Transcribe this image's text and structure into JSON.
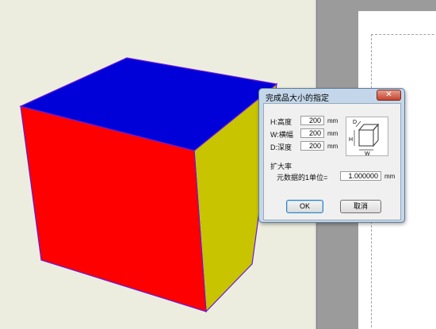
{
  "dialog": {
    "title": "完成品大小的指定",
    "close_glyph": "✕",
    "height_label": "H:高度",
    "height_value": "200",
    "width_label": "W:横幅",
    "width_value": "200",
    "depth_label": "D:深度",
    "depth_value": "200",
    "unit": "mm",
    "scale_heading": "扩大率",
    "scale_label": "元数据的1单位=",
    "scale_value": "1.000000",
    "ok_label": "OK",
    "cancel_label": "取消",
    "diagram": {
      "d": "D",
      "h": "H",
      "w": "W"
    }
  },
  "colors": {
    "cube_top": "#0000d8",
    "cube_front": "#ff0000",
    "cube_side": "#c8c400",
    "cube_edge": "#6a1bd6"
  }
}
